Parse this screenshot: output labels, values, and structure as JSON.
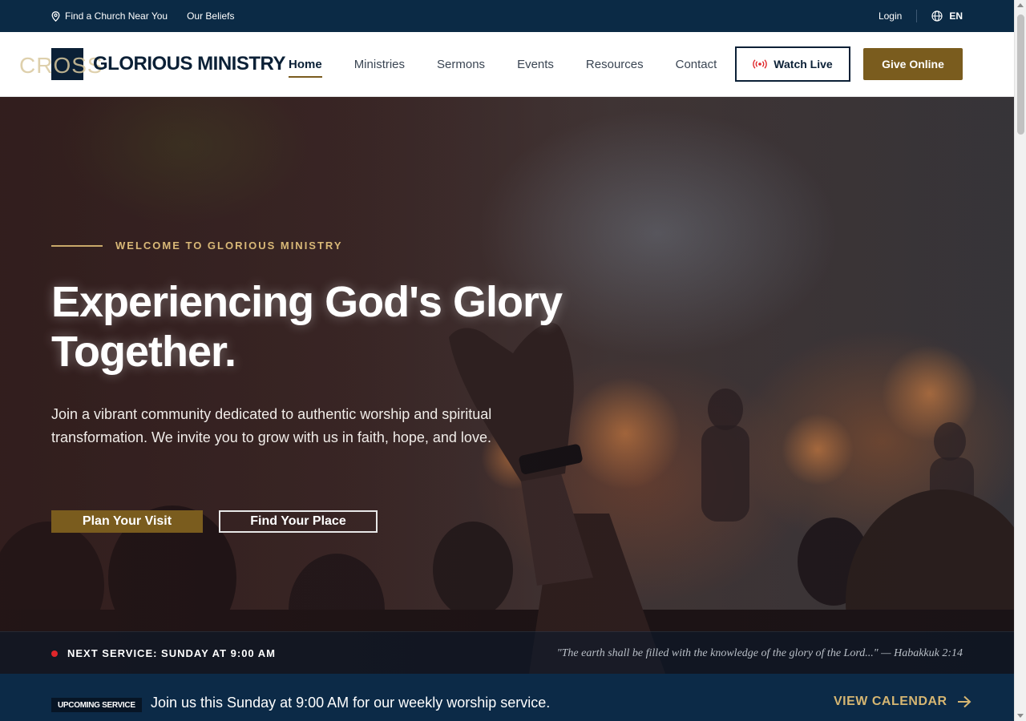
{
  "topbar": {
    "find_church": "Find a Church Near You",
    "beliefs": "Our Beliefs",
    "login": "Login",
    "language": "EN"
  },
  "header": {
    "logo_watermark": "CROSS",
    "logo_name": "GLORIOUS MINISTRY",
    "nav": [
      {
        "label": "Home",
        "active": true
      },
      {
        "label": "Ministries"
      },
      {
        "label": "Sermons"
      },
      {
        "label": "Events"
      },
      {
        "label": "Resources"
      },
      {
        "label": "Contact"
      }
    ],
    "watch_live": "Watch Live",
    "give_online": "Give Online"
  },
  "hero": {
    "eyebrow": "WELCOME TO GLORIOUS MINISTRY",
    "headline_line1": "Experiencing God's Glory",
    "headline_line2": "Together.",
    "subtext": "Join a vibrant community dedicated to authentic worship and spiritual transformation. We invite you to grow with us in faith, hope, and love.",
    "cta_primary": "Plan Your Visit",
    "cta_secondary": "Find Your Place"
  },
  "service_strip": {
    "next_service": "NEXT SERVICE: SUNDAY AT 9:00 AM",
    "verse": "\"The earth shall be filled with the knowledge of the glory of the Lord...\" — Habakkuk 2:14"
  },
  "announcement": {
    "badge": "UPCOMING SERVICE",
    "message": "Join us this Sunday at 9:00 AM for our weekly worship service.",
    "link": "VIEW CALENDAR"
  },
  "colors": {
    "navy": "#0b2a45",
    "gold": "#7a5c1e",
    "gold_light": "#d9b877",
    "live_red": "#e0262a"
  },
  "icons": {
    "location": "map-pin-icon",
    "globe": "globe-icon",
    "live": "broadcast-icon",
    "arrow": "arrow-right-icon"
  }
}
